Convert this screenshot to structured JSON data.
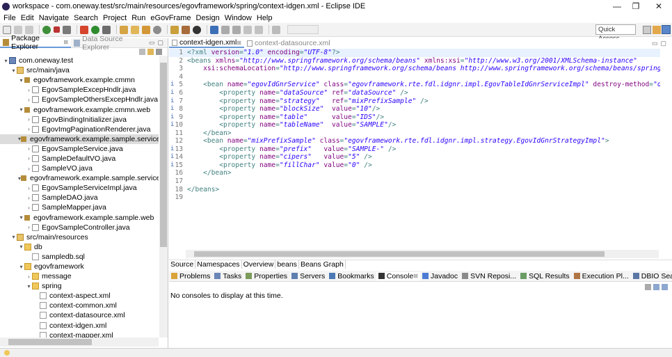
{
  "window": {
    "title": "workspace - com.oneway.test/src/main/resources/egovframework/spring/context-idgen.xml - Eclipse IDE",
    "minimize": "—",
    "maximize": "❐",
    "close": "✕"
  },
  "menu": [
    "File",
    "Edit",
    "Navigate",
    "Search",
    "Project",
    "Run",
    "eGovFrame",
    "Design",
    "Window",
    "Help"
  ],
  "toolbar": {
    "quick_access": "Quick Access"
  },
  "left_panel": {
    "tabs": [
      {
        "label": "Package Explorer",
        "active": true
      },
      {
        "label": "Data Source Explorer",
        "active": false
      }
    ],
    "tree": [
      {
        "level": 0,
        "arrow": "▾",
        "icon": "proj",
        "label": "com.oneway.test"
      },
      {
        "level": 1,
        "arrow": "▾",
        "icon": "src",
        "label": "src/main/java"
      },
      {
        "level": 2,
        "arrow": "▾",
        "icon": "pkg",
        "label": "egovframework.example.cmmn"
      },
      {
        "level": 3,
        "arrow": "›",
        "icon": "java",
        "label": "EgovSampleExcepHndlr.java"
      },
      {
        "level": 3,
        "arrow": "›",
        "icon": "java",
        "label": "EgovSampleOthersExcepHndlr.java"
      },
      {
        "level": 2,
        "arrow": "▾",
        "icon": "pkg",
        "label": "egovframework.example.cmmn.web"
      },
      {
        "level": 3,
        "arrow": "›",
        "icon": "java",
        "label": "EgovBindingInitializer.java"
      },
      {
        "level": 3,
        "arrow": "›",
        "icon": "java",
        "label": "EgovImgPaginationRenderer.java"
      },
      {
        "level": 2,
        "arrow": "▾",
        "icon": "pkg",
        "label": "egovframework.example.sample.service",
        "selected": true
      },
      {
        "level": 3,
        "arrow": "›",
        "icon": "java",
        "label": "EgovSampleService.java"
      },
      {
        "level": 3,
        "arrow": "›",
        "icon": "java",
        "label": "SampleDefaultVO.java"
      },
      {
        "level": 3,
        "arrow": "›",
        "icon": "java",
        "label": "SampleVO.java"
      },
      {
        "level": 2,
        "arrow": "▾",
        "icon": "pkg",
        "label": "egovframework.example.sample.service.imp"
      },
      {
        "level": 3,
        "arrow": "›",
        "icon": "java",
        "label": "EgovSampleServiceImpl.java"
      },
      {
        "level": 3,
        "arrow": "›",
        "icon": "java",
        "label": "SampleDAO.java"
      },
      {
        "level": 3,
        "arrow": "›",
        "icon": "java",
        "label": "SampleMapper.java"
      },
      {
        "level": 2,
        "arrow": "▾",
        "icon": "pkg",
        "label": "egovframework.example.sample.web"
      },
      {
        "level": 3,
        "arrow": "›",
        "icon": "java",
        "label": "EgovSampleController.java"
      },
      {
        "level": 1,
        "arrow": "▾",
        "icon": "src",
        "label": "src/main/resources"
      },
      {
        "level": 2,
        "arrow": "▾",
        "icon": "fold",
        "label": "db"
      },
      {
        "level": 3,
        "arrow": "",
        "icon": "sql",
        "label": "sampledb.sql"
      },
      {
        "level": 2,
        "arrow": "▾",
        "icon": "fold",
        "label": "egovframework"
      },
      {
        "level": 3,
        "arrow": "›",
        "icon": "fold",
        "label": "message"
      },
      {
        "level": 3,
        "arrow": "▾",
        "icon": "fold",
        "label": "spring"
      },
      {
        "level": 4,
        "arrow": "",
        "icon": "xml",
        "label": "context-aspect.xml"
      },
      {
        "level": 4,
        "arrow": "",
        "icon": "xml",
        "label": "context-common.xml"
      },
      {
        "level": 4,
        "arrow": "",
        "icon": "xml",
        "label": "context-datasource.xml"
      },
      {
        "level": 4,
        "arrow": "",
        "icon": "xml",
        "label": "context-idgen.xml"
      },
      {
        "level": 4,
        "arrow": "",
        "icon": "xml",
        "label": "context-mapper.xml"
      }
    ]
  },
  "editor": {
    "tabs": [
      {
        "label": "context-idgen.xml",
        "active": true
      },
      {
        "label": "context-datasource.xml",
        "active": false
      }
    ],
    "lines": [
      {
        "num": "1",
        "marker": "",
        "segs": [
          [
            "pi",
            "<?xml "
          ],
          [
            "attr",
            "version"
          ],
          [
            "pi",
            "="
          ],
          [
            "val",
            "\"1.0\""
          ],
          [
            "pi",
            " "
          ],
          [
            "attr",
            "encoding"
          ],
          [
            "pi",
            "="
          ],
          [
            "val",
            "\"UTF-8\""
          ],
          [
            "pi",
            "?>"
          ]
        ]
      },
      {
        "num": "2",
        "marker": "",
        "segs": [
          [
            "tag",
            "<beans "
          ],
          [
            "attr",
            "xmlns"
          ],
          [
            "tag",
            "="
          ],
          [
            "val",
            "\"http://www.springframework.org/schema/beans\""
          ],
          [
            "tag",
            " "
          ],
          [
            "attr",
            "xmlns:xsi"
          ],
          [
            "tag",
            "="
          ],
          [
            "val",
            "\"http://www.w3.org/2001/XMLSchema-instance\""
          ]
        ]
      },
      {
        "num": "3",
        "marker": "",
        "segs": [
          [
            "tag",
            "    "
          ],
          [
            "attr",
            "xsi:schemaLocation"
          ],
          [
            "tag",
            "="
          ],
          [
            "val",
            "\"http://www.springframework.org/schema/beans http://www.springframework.org/schema/beans/spring-beans"
          ]
        ]
      },
      {
        "num": "4",
        "marker": "",
        "segs": [
          [
            "tag",
            ""
          ]
        ]
      },
      {
        "num": "5",
        "marker": "i",
        "segs": [
          [
            "tag",
            "    <bean "
          ],
          [
            "attr",
            "name"
          ],
          [
            "tag",
            "="
          ],
          [
            "val",
            "\"egovIdGnrService\""
          ],
          [
            "tag",
            " "
          ],
          [
            "attr",
            "class"
          ],
          [
            "tag",
            "="
          ],
          [
            "val",
            "\"egovframework.rte.fdl.idgnr.impl.EgovTableIdGnrServiceImpl\""
          ],
          [
            "tag",
            " "
          ],
          [
            "attr",
            "destroy-method"
          ],
          [
            "tag",
            "="
          ],
          [
            "val",
            "\"destroy\""
          ]
        ]
      },
      {
        "num": "6",
        "marker": "i",
        "segs": [
          [
            "tag",
            "        <property "
          ],
          [
            "attr",
            "name"
          ],
          [
            "tag",
            "="
          ],
          [
            "val",
            "\"dataSource\""
          ],
          [
            "tag",
            " "
          ],
          [
            "attr",
            "ref"
          ],
          [
            "tag",
            "="
          ],
          [
            "val",
            "\"dataSource\""
          ],
          [
            "tag",
            " />"
          ]
        ]
      },
      {
        "num": "7",
        "marker": "i",
        "segs": [
          [
            "tag",
            "        <property "
          ],
          [
            "attr",
            "name"
          ],
          [
            "tag",
            "="
          ],
          [
            "val",
            "\"strategy\""
          ],
          [
            "tag",
            "   "
          ],
          [
            "attr",
            "ref"
          ],
          [
            "tag",
            "="
          ],
          [
            "val",
            "\"mixPrefixSample\""
          ],
          [
            "tag",
            " />"
          ]
        ]
      },
      {
        "num": "8",
        "marker": "i",
        "segs": [
          [
            "tag",
            "        <property "
          ],
          [
            "attr",
            "name"
          ],
          [
            "tag",
            "="
          ],
          [
            "val",
            "\"blockSize\""
          ],
          [
            "tag",
            "  "
          ],
          [
            "attr",
            "value"
          ],
          [
            "tag",
            "="
          ],
          [
            "val",
            "\"10\""
          ],
          [
            "tag",
            "/>"
          ]
        ]
      },
      {
        "num": "9",
        "marker": "i",
        "segs": [
          [
            "tag",
            "        <property "
          ],
          [
            "attr",
            "name"
          ],
          [
            "tag",
            "="
          ],
          [
            "val",
            "\"table\""
          ],
          [
            "tag",
            "      "
          ],
          [
            "attr",
            "value"
          ],
          [
            "tag",
            "="
          ],
          [
            "val",
            "\"IDS\""
          ],
          [
            "tag",
            "/>"
          ]
        ]
      },
      {
        "num": "10",
        "marker": "i",
        "segs": [
          [
            "tag",
            "        <property "
          ],
          [
            "attr",
            "name"
          ],
          [
            "tag",
            "="
          ],
          [
            "val",
            "\"tableName\""
          ],
          [
            "tag",
            "  "
          ],
          [
            "attr",
            "value"
          ],
          [
            "tag",
            "="
          ],
          [
            "val",
            "\"SAMPLE\""
          ],
          [
            "tag",
            "/>"
          ]
        ]
      },
      {
        "num": "11",
        "marker": "",
        "segs": [
          [
            "tag",
            "    </bean>"
          ]
        ]
      },
      {
        "num": "12",
        "marker": "",
        "segs": [
          [
            "tag",
            "    <bean "
          ],
          [
            "attr",
            "name"
          ],
          [
            "tag",
            "="
          ],
          [
            "val",
            "\"mixPrefixSample\""
          ],
          [
            "tag",
            " "
          ],
          [
            "attr",
            "class"
          ],
          [
            "tag",
            "="
          ],
          [
            "val",
            "\"egovframework.rte.fdl.idgnr.impl.strategy.EgovIdGnrStrategyImpl\""
          ],
          [
            "tag",
            ">"
          ]
        ]
      },
      {
        "num": "13",
        "marker": "i",
        "segs": [
          [
            "tag",
            "        <property "
          ],
          [
            "attr",
            "name"
          ],
          [
            "tag",
            "="
          ],
          [
            "val",
            "\"prefix\""
          ],
          [
            "tag",
            "   "
          ],
          [
            "attr",
            "value"
          ],
          [
            "tag",
            "="
          ],
          [
            "val",
            "\"SAMPLE-\""
          ],
          [
            "tag",
            " />"
          ]
        ]
      },
      {
        "num": "14",
        "marker": "i",
        "segs": [
          [
            "tag",
            "        <property "
          ],
          [
            "attr",
            "name"
          ],
          [
            "tag",
            "="
          ],
          [
            "val",
            "\"cipers\""
          ],
          [
            "tag",
            "   "
          ],
          [
            "attr",
            "value"
          ],
          [
            "tag",
            "="
          ],
          [
            "val",
            "\"5\""
          ],
          [
            "tag",
            " />"
          ]
        ]
      },
      {
        "num": "15",
        "marker": "i",
        "segs": [
          [
            "tag",
            "        <property "
          ],
          [
            "attr",
            "name"
          ],
          [
            "tag",
            "="
          ],
          [
            "val",
            "\"fillChar\""
          ],
          [
            "tag",
            " "
          ],
          [
            "attr",
            "value"
          ],
          [
            "tag",
            "="
          ],
          [
            "val",
            "\"0\""
          ],
          [
            "tag",
            " />"
          ]
        ]
      },
      {
        "num": "16",
        "marker": "",
        "segs": [
          [
            "tag",
            "    </bean>"
          ]
        ]
      },
      {
        "num": "17",
        "marker": "",
        "segs": [
          [
            "tag",
            ""
          ]
        ]
      },
      {
        "num": "18",
        "marker": "",
        "segs": [
          [
            "tag",
            "</beans>"
          ]
        ]
      },
      {
        "num": "19",
        "marker": "",
        "segs": [
          [
            "tag",
            ""
          ]
        ]
      }
    ],
    "bottom_tabs": [
      "Source",
      "Namespaces",
      "Overview",
      "beans",
      "Beans Graph"
    ]
  },
  "console": {
    "tabs": [
      {
        "label": "Problems",
        "active": false
      },
      {
        "label": "Tasks",
        "active": false
      },
      {
        "label": "Properties",
        "active": false
      },
      {
        "label": "Servers",
        "active": false
      },
      {
        "label": "Bookmarks",
        "active": false
      },
      {
        "label": "Console",
        "active": true
      },
      {
        "label": "Javadoc",
        "active": false
      },
      {
        "label": "SVN Reposi...",
        "active": false
      },
      {
        "label": "SQL Results",
        "active": false
      },
      {
        "label": "Execution Pl...",
        "active": false
      },
      {
        "label": "DBIO Search",
        "active": false
      },
      {
        "label": "Query Result",
        "active": false
      }
    ],
    "message": "No consoles to display at this time."
  },
  "colors": {
    "tag": "#3f7f7f",
    "attr": "#7f007f",
    "value": "#2a00ff",
    "selection": "#dcdcdc"
  }
}
